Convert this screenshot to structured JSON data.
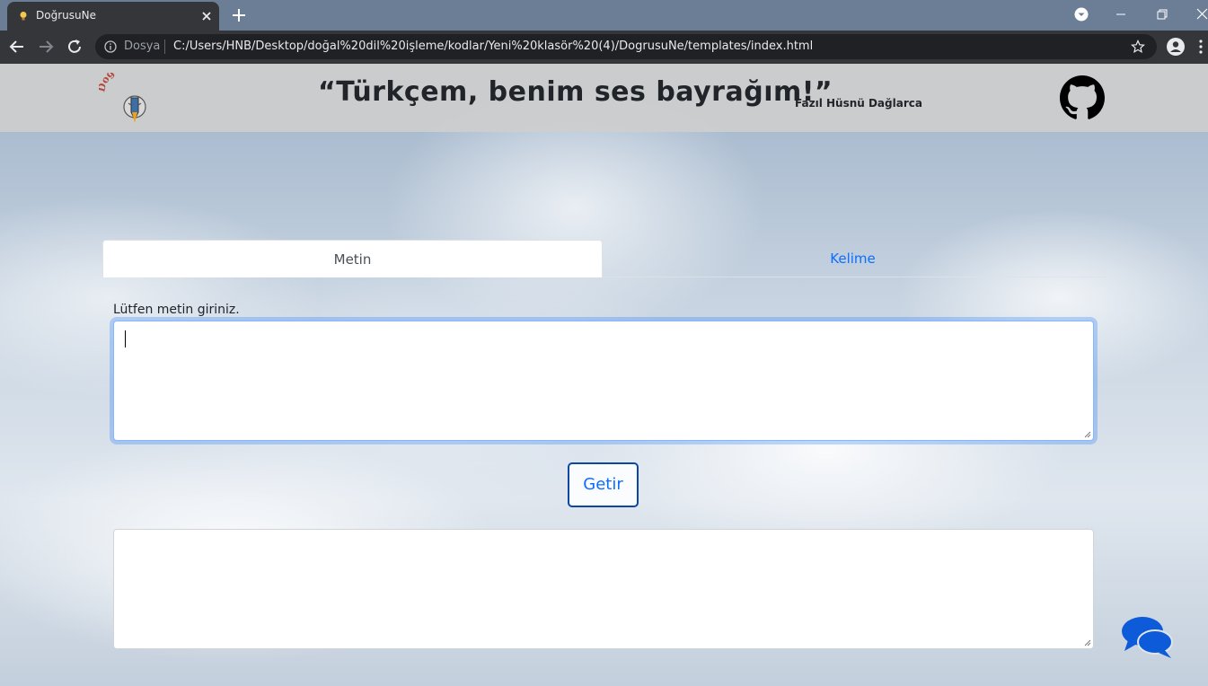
{
  "browser": {
    "tab_title": "DoğrusuNe",
    "scheme_label": "Dosya",
    "url": "C:/Users/HNB/Desktop/doğal%20dil%20işleme/kodlar/Yeni%20klasör%20(4)/DogrusuNe/templates/index.html"
  },
  "header": {
    "logo_text": "DoğrusuNe",
    "quote": "“Türkçem, benim ses bayrağım!”",
    "quote_author": "Fazıl Hüsnü Dağlarca"
  },
  "tabs": [
    {
      "label": "Metin",
      "active": true
    },
    {
      "label": "Kelime",
      "active": false
    }
  ],
  "form": {
    "input_label": "Lütfen metin giriniz.",
    "input_value": "",
    "submit_label": "Getir",
    "output_value": ""
  },
  "colors": {
    "link_blue": "#0d6efd",
    "button_border": "#0d47a1",
    "chat_blue": "#0d5bd9",
    "logo_red": "#b5473a"
  }
}
